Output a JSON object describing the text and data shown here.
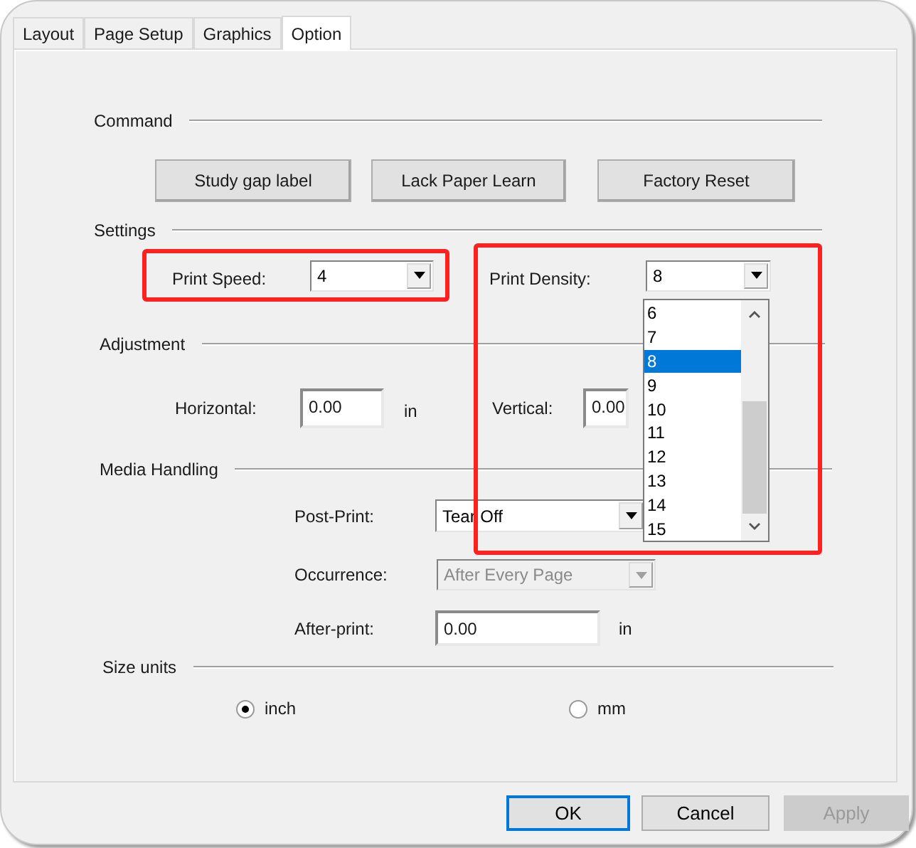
{
  "tabs": [
    {
      "label": "Layout",
      "selected": false
    },
    {
      "label": "Page Setup",
      "selected": false
    },
    {
      "label": "Graphics",
      "selected": false
    },
    {
      "label": "Option",
      "selected": true
    }
  ],
  "command": {
    "heading": "Command",
    "buttons": [
      "Study gap label",
      "Lack Paper Learn",
      "Factory Reset"
    ]
  },
  "settings": {
    "heading": "Settings",
    "print_speed": {
      "label": "Print Speed:",
      "value": "4",
      "highlighted": true
    },
    "print_density": {
      "label": "Print Density:",
      "value": "8",
      "highlighted": true,
      "expanded": true,
      "options": [
        {
          "label": "6",
          "selected": false
        },
        {
          "label": "7",
          "selected": false
        },
        {
          "label": "8",
          "selected": true
        },
        {
          "label": "9",
          "selected": false
        },
        {
          "label": "10",
          "selected": false
        },
        {
          "label": "11",
          "selected": false
        },
        {
          "label": "12",
          "selected": false
        },
        {
          "label": "13",
          "selected": false
        },
        {
          "label": "14",
          "selected": false
        },
        {
          "label": "15",
          "selected": false
        }
      ]
    }
  },
  "adjustment": {
    "heading": "Adjustment",
    "horizontal": {
      "label": "Horizontal:",
      "value": "0.00",
      "unit": "in"
    },
    "vertical": {
      "label": "Vertical:",
      "value": "0.00"
    }
  },
  "media_handling": {
    "heading": "Media Handling",
    "post_print": {
      "label": "Post-Print:",
      "value": "Tear Off",
      "disabled": false
    },
    "occurrence": {
      "label": "Occurrence:",
      "value": "After Every Page",
      "disabled": true
    },
    "after_print": {
      "label": "After-print:",
      "value": "0.00",
      "unit": "in"
    }
  },
  "size_units": {
    "heading": "Size units",
    "options": [
      {
        "label": "inch",
        "selected": true
      },
      {
        "label": "mm",
        "selected": false
      }
    ]
  },
  "buttons": [
    {
      "label": "OK",
      "focused": true,
      "disabled": false
    },
    {
      "label": "Cancel",
      "focused": false,
      "disabled": false
    },
    {
      "label": "Apply",
      "focused": false,
      "disabled": true
    }
  ]
}
